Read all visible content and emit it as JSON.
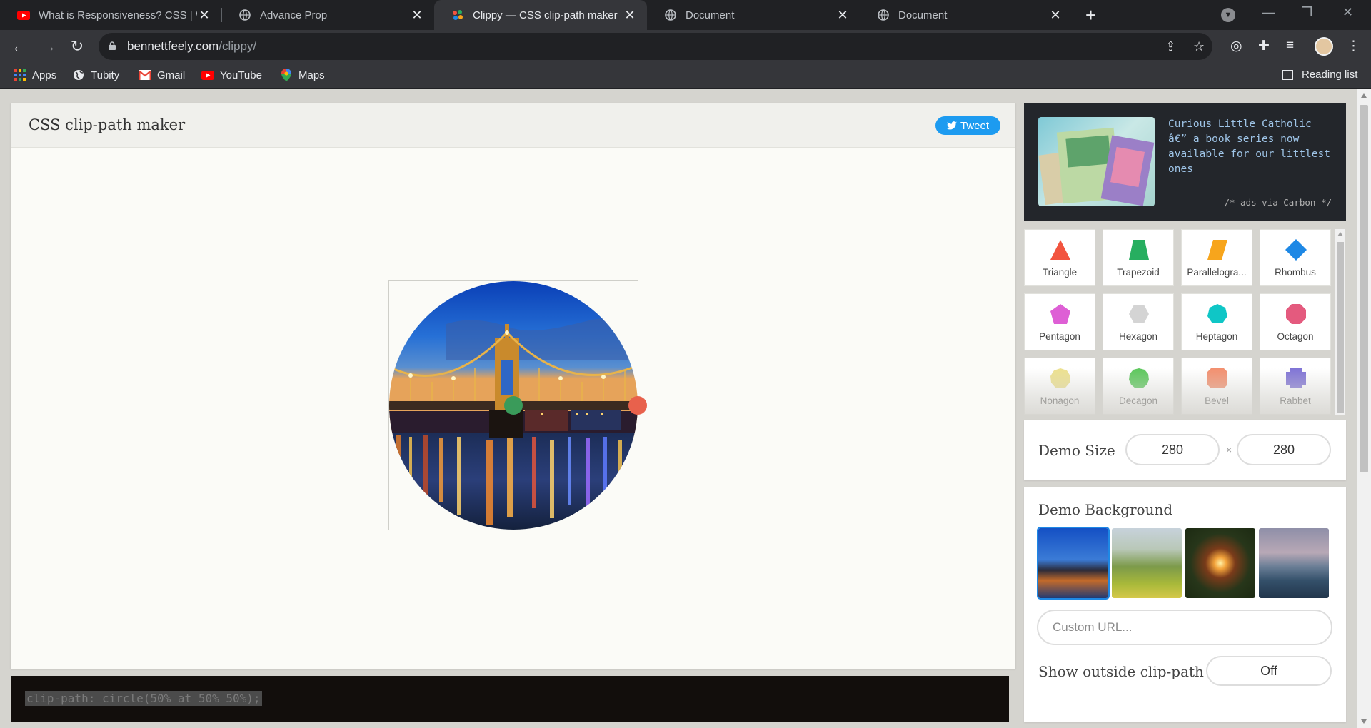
{
  "browser": {
    "tabs": [
      {
        "title": "What is Responsiveness? CSS | W",
        "favicon": "youtube-icon",
        "active": false
      },
      {
        "title": "Advance Prop",
        "favicon": "globe-icon",
        "active": false
      },
      {
        "title": "Clippy — CSS clip-path maker",
        "favicon": "clippy-icon",
        "active": true
      },
      {
        "title": "Document",
        "favicon": "globe-icon",
        "active": false
      },
      {
        "title": "Document",
        "favicon": "globe-icon",
        "active": false
      }
    ],
    "url_host": "bennettfeely.com",
    "url_path": "/clippy/",
    "bookmarks": [
      {
        "label": "Apps",
        "icon": "apps-grid-icon"
      },
      {
        "label": "Tubity",
        "icon": "globe-icon"
      },
      {
        "label": "Gmail",
        "icon": "gmail-icon"
      },
      {
        "label": "YouTube",
        "icon": "youtube-icon"
      },
      {
        "label": "Maps",
        "icon": "maps-icon"
      }
    ],
    "reading_list": "Reading list"
  },
  "main": {
    "title": "CSS clip-path maker",
    "tweet_label": "Tweet",
    "code": "clip-path: circle(50% at 50% 50%);"
  },
  "ad": {
    "text": "Curious Little Catholic â€” a book series now available for our littlest ones",
    "via": "/* ads via Carbon */"
  },
  "shapes": [
    {
      "label": "Triangle",
      "color": "#f2543f",
      "icon": "triangle-shape-icon"
    },
    {
      "label": "Trapezoid",
      "color": "#27ae60",
      "icon": "trapezoid-shape-icon"
    },
    {
      "label": "Parallelogra...",
      "color": "#f7a51c",
      "icon": "parallelogram-shape-icon"
    },
    {
      "label": "Rhombus",
      "color": "#1e88e5",
      "icon": "rhombus-shape-icon"
    },
    {
      "label": "Pentagon",
      "color": "#de5fd5",
      "icon": "pentagon-shape-icon"
    },
    {
      "label": "Hexagon",
      "color": "#d4d4d4",
      "icon": "hexagon-shape-icon"
    },
    {
      "label": "Heptagon",
      "color": "#0fc6c6",
      "icon": "heptagon-shape-icon"
    },
    {
      "label": "Octagon",
      "color": "#e45a7e",
      "icon": "octagon-shape-icon"
    },
    {
      "label": "Nonagon",
      "color": "#ede18f",
      "icon": "nonagon-shape-icon"
    },
    {
      "label": "Decagon",
      "color": "#5cc85c",
      "icon": "decagon-shape-icon"
    },
    {
      "label": "Bevel",
      "color": "#f3906f",
      "icon": "bevel-shape-icon"
    },
    {
      "label": "Rabbet",
      "color": "#8074d6",
      "icon": "rabbet-shape-icon"
    }
  ],
  "demo_size": {
    "label": "Demo Size",
    "width": "280",
    "height": "280",
    "separator": "×"
  },
  "demo_background": {
    "label": "Demo Background",
    "thumbnails": [
      "bridge-night",
      "green-valley",
      "sparkler",
      "ocean-waves"
    ],
    "custom_url_placeholder": "Custom URL..."
  },
  "outside_clip": {
    "label": "Show outside clip-path",
    "value": "Off"
  },
  "colors": {
    "accent_green": "#3a9b5a",
    "accent_red": "#e8614c",
    "tweet_blue": "#1d9bf0"
  }
}
